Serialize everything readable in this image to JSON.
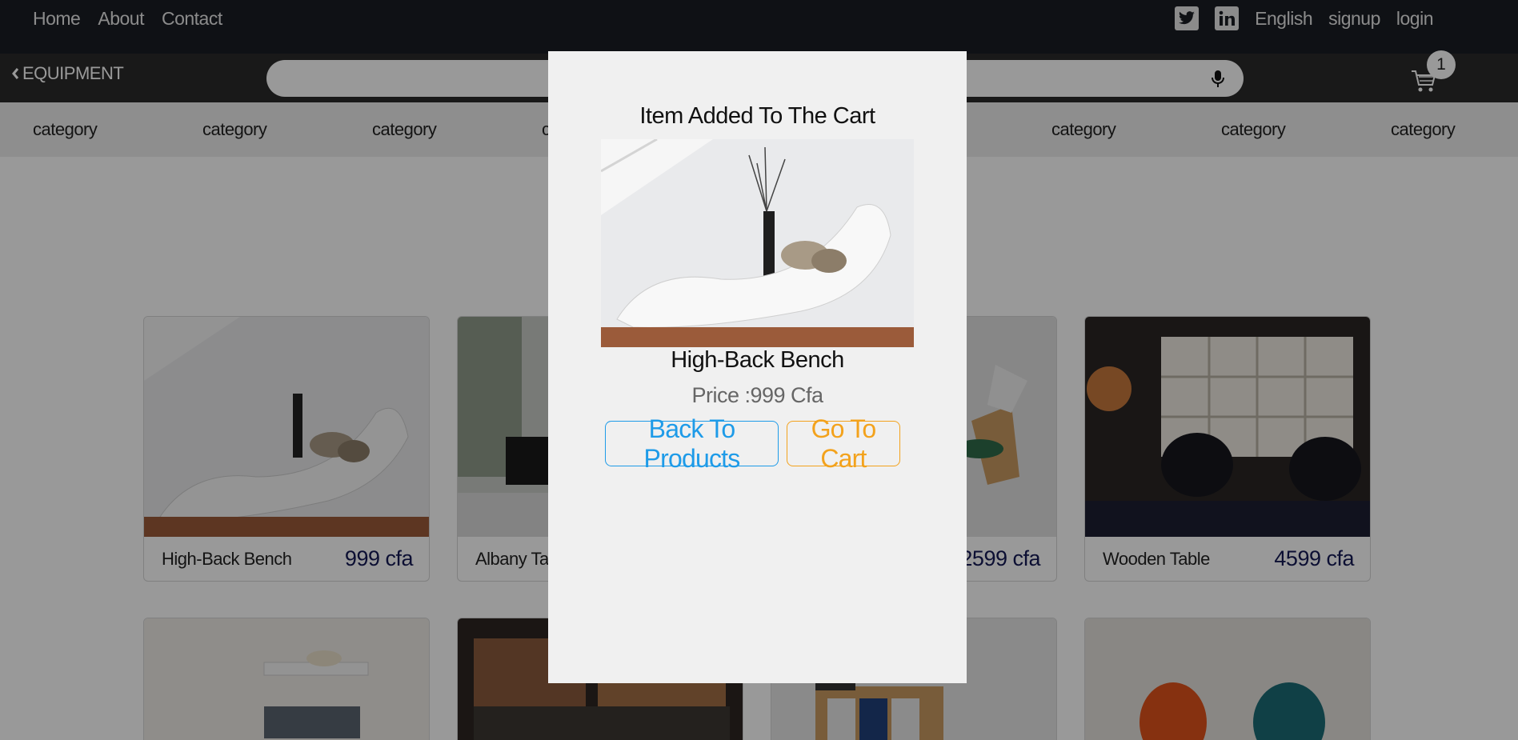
{
  "nav": {
    "links": [
      "Home",
      "About",
      "Contact"
    ],
    "language": "English",
    "signup": "signup",
    "login": "login"
  },
  "subbar": {
    "back_label": "EQUIPMENT",
    "search_placeholder": "",
    "cart_count": "1"
  },
  "categories": [
    "category",
    "category",
    "category",
    "c",
    "category",
    "category",
    "category"
  ],
  "products": [
    {
      "name": "High-Back Bench",
      "price": "999 cfa"
    },
    {
      "name": "Albany Tabl",
      "price": ""
    },
    {
      "name": "",
      "price": "2599 cfa"
    },
    {
      "name": "Wooden Table",
      "price": "4599 cfa"
    }
  ],
  "modal": {
    "title": "Item Added To The Cart",
    "product_name": "High-Back Bench",
    "price": "Price :999 Cfa",
    "back_button": "Back To Products",
    "cart_button": "Go To Cart"
  },
  "colors": {
    "navbar": "#1a1d24",
    "subbar": "#2b2b2b",
    "price": "#151a55",
    "back_button": "#1e9be8",
    "cart_button": "#f3a21c",
    "modal_bg": "#f0f0f0"
  },
  "icons": [
    "twitter-icon",
    "linkedin-icon",
    "chevron-left-icon",
    "microphone-icon",
    "cart-icon"
  ]
}
